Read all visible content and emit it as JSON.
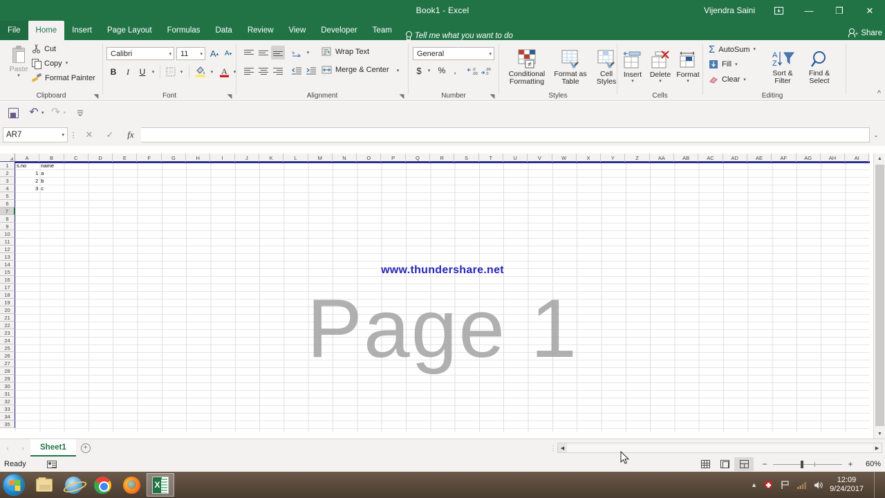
{
  "titlebar": {
    "title": "Book1  -  Excel",
    "user": "Vijendra Saini",
    "ribbon_display_icon": "ribbon-display-options-icon",
    "minimize": "—",
    "restore": "❐",
    "close": "✕"
  },
  "tabs": {
    "items": [
      {
        "label": "File",
        "active": false
      },
      {
        "label": "Home",
        "active": true
      },
      {
        "label": "Insert",
        "active": false
      },
      {
        "label": "Page Layout",
        "active": false
      },
      {
        "label": "Formulas",
        "active": false
      },
      {
        "label": "Data",
        "active": false
      },
      {
        "label": "Review",
        "active": false
      },
      {
        "label": "View",
        "active": false
      },
      {
        "label": "Developer",
        "active": false
      },
      {
        "label": "Team",
        "active": false
      }
    ],
    "tellme": "Tell me what you want to do",
    "share": "Share"
  },
  "ribbon": {
    "clipboard": {
      "group_label": "Clipboard",
      "paste": "Paste",
      "cut": "Cut",
      "copy": "Copy",
      "format_painter": "Format Painter"
    },
    "font": {
      "group_label": "Font",
      "font_name": "Calibri",
      "font_size": "11",
      "grow_font": "A",
      "shrink_font": "A",
      "bold": "B",
      "italic": "I",
      "underline": "U"
    },
    "alignment": {
      "group_label": "Alignment",
      "wrap_text": "Wrap Text",
      "merge_center": "Merge & Center"
    },
    "number": {
      "group_label": "Number",
      "format": "General",
      "currency": "$",
      "percent": "%",
      "comma": ","
    },
    "styles": {
      "group_label": "Styles",
      "conditional_formatting": "Conditional\nFormatting",
      "conditional_formatting_l1": "Conditional",
      "conditional_formatting_l2": "Formatting",
      "format_as_table_l1": "Format as",
      "format_as_table_l2": "Table",
      "cell_styles_l1": "Cell",
      "cell_styles_l2": "Styles"
    },
    "cells": {
      "group_label": "Cells",
      "insert": "Insert",
      "delete": "Delete",
      "format": "Format"
    },
    "editing": {
      "group_label": "Editing",
      "autosum": "AutoSum",
      "fill": "Fill",
      "clear": "Clear",
      "sort_filter_l1": "Sort &",
      "sort_filter_l2": "Filter",
      "find_select_l1": "Find &",
      "find_select_l2": "Select"
    },
    "collapse_ribbon": "^"
  },
  "qat": {
    "save": "save-icon",
    "undo": "undo-icon",
    "redo": "redo-icon",
    "customize": "customize-qat-icon"
  },
  "formula_bar": {
    "name_box": "AR7",
    "cancel": "✕",
    "enter": "✓",
    "insert_function": "fx",
    "formula_value": "",
    "expand": "⌄"
  },
  "grid": {
    "columns": [
      "A",
      "B",
      "C",
      "D",
      "E",
      "F",
      "G",
      "H",
      "I",
      "J",
      "K",
      "L",
      "M",
      "N",
      "O",
      "P",
      "Q",
      "R",
      "S",
      "T",
      "U",
      "V",
      "W",
      "X",
      "Y",
      "Z",
      "AA",
      "AB",
      "AC",
      "AD",
      "AE",
      "AF",
      "AG",
      "AH",
      "AI"
    ],
    "rows": [
      1,
      2,
      3,
      4,
      5,
      6,
      7,
      8,
      9,
      10,
      11,
      12,
      13,
      14,
      15,
      16,
      17,
      18,
      19,
      20,
      21,
      22,
      23,
      24,
      25,
      26,
      27,
      28,
      29,
      30,
      31,
      32,
      33,
      34,
      35
    ],
    "selected_row": 7,
    "cells": [
      {
        "row": 1,
        "a": "s.no",
        "b": "name",
        "a_num": false
      },
      {
        "row": 2,
        "a": "1",
        "b": "a",
        "a_num": true
      },
      {
        "row": 3,
        "a": "2",
        "b": "b",
        "a_num": true
      },
      {
        "row": 4,
        "a": "3",
        "b": "c",
        "a_num": true
      }
    ],
    "watermark_link": "www.thundershare.net",
    "watermark_page": "Page 1"
  },
  "sheetbar": {
    "prev": "‹",
    "next": "›",
    "sheets": [
      "Sheet1"
    ],
    "active_sheet": "Sheet1",
    "add_sheet": "+"
  },
  "statusbar": {
    "status": "Ready",
    "macro_record": "record-macro-icon",
    "views": [
      {
        "name": "normal-view",
        "active": false
      },
      {
        "name": "page-layout-view",
        "active": false
      },
      {
        "name": "page-break-preview",
        "active": true
      }
    ],
    "zoom_out": "−",
    "zoom_in": "+",
    "zoom_level": "60%"
  },
  "taskbar": {
    "start": "start-orb",
    "items": [
      {
        "name": "file-explorer",
        "active": false
      },
      {
        "name": "internet-explorer",
        "active": false
      },
      {
        "name": "google-chrome",
        "active": false
      },
      {
        "name": "mozilla-firefox",
        "active": false
      },
      {
        "name": "microsoft-excel",
        "active": true
      }
    ],
    "tray": [
      "show-hidden-icons",
      "antivirus-icon",
      "action-center-flag-icon",
      "network-icon",
      "volume-icon"
    ],
    "time": "12:09",
    "date": "9/24/2017"
  },
  "colors": {
    "excel_green": "#217346",
    "ribbon_bg": "#f3f2f1",
    "watermark_link": "#2727b5",
    "watermark_page": "#a3a3a3",
    "grid_line": "#dfdfdf",
    "page_border": "#2f2f8f"
  }
}
